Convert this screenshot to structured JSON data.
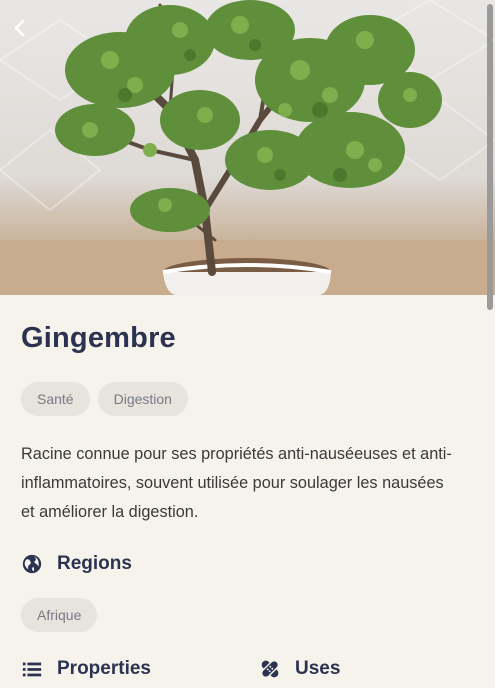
{
  "header": {
    "back_icon": "chevron-left-icon",
    "image_subject": "jade-plant-in-white-pot"
  },
  "plant": {
    "name": "Gingembre",
    "tags": [
      "Santé",
      "Digestion"
    ],
    "description": "Racine connue pour ses propriétés anti-nauséeuses et anti-inflammatoires, souvent utilisée pour soulager les nausées et améliorer la digestion."
  },
  "sections": {
    "regions": {
      "label": "Regions",
      "icon": "globe-icon",
      "items": [
        "Afrique"
      ]
    },
    "properties": {
      "label": "Properties",
      "icon": "list-icon"
    },
    "uses": {
      "label": "Uses",
      "icon": "bandage-icon"
    }
  },
  "colors": {
    "background": "#f6f3ec",
    "title": "#2c3350",
    "chip_bg": "#e7e4dd",
    "chip_text": "#777a85",
    "body_text": "#3a3a3a"
  }
}
